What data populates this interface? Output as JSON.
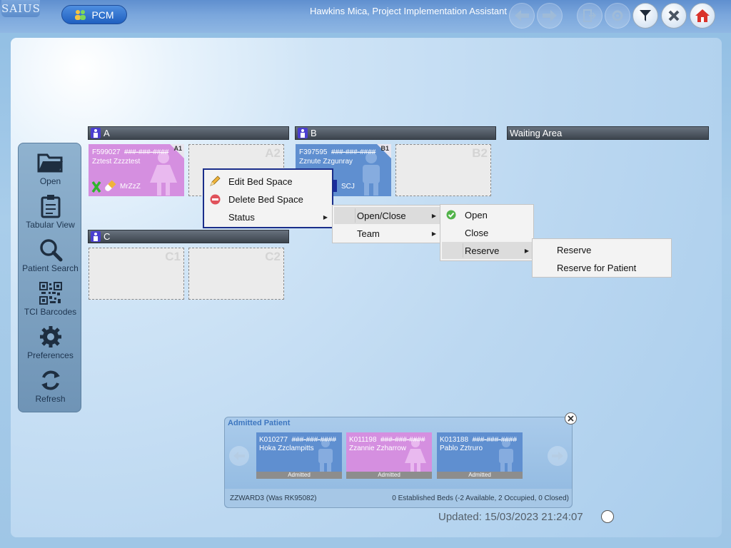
{
  "app": {
    "logo": "SAIUS",
    "module_button": "PCM",
    "user_title": "Hawkins Mica, Project Implementation Assistant"
  },
  "sidebar": {
    "items": [
      {
        "label": "Open",
        "icon": "folder-open-icon"
      },
      {
        "label": "Tabular View",
        "icon": "clipboard-icon"
      },
      {
        "label": "Patient Search",
        "icon": "magnifier-icon"
      },
      {
        "label": "TCI Barcodes",
        "icon": "qr-code-icon"
      },
      {
        "label": "Preferences",
        "icon": "gear-icon"
      },
      {
        "label": "Refresh",
        "icon": "refresh-icon"
      }
    ]
  },
  "groups": [
    {
      "name": "A"
    },
    {
      "name": "B"
    },
    {
      "name": "Waiting Area"
    },
    {
      "name": "C"
    }
  ],
  "beds": {
    "A1": {
      "id": "A1",
      "nhs": "F599027",
      "mask": "###-###-####",
      "name": "Zztest Zzzztest",
      "consultant": "MrZzZ",
      "color": "#d58fe0"
    },
    "A2": {
      "id": "A2"
    },
    "B1": {
      "id": "B1",
      "nhs": "F397595",
      "mask": "###-###-####",
      "name": "Zznute Zzgunray",
      "specialty": "SCJ",
      "color": "#5f8fd0"
    },
    "B2": {
      "id": "B2"
    },
    "C1": {
      "id": "C1"
    },
    "C2": {
      "id": "C2"
    }
  },
  "context_menu": {
    "main": [
      {
        "label": "Edit Bed Space",
        "icon": "pencil-icon"
      },
      {
        "label": "Delete Bed Space",
        "icon": "delete-icon"
      },
      {
        "label": "Status"
      }
    ],
    "status": [
      {
        "label": "Open/Close"
      },
      {
        "label": "Team"
      }
    ],
    "open_close": [
      {
        "label": "Open",
        "icon": "check-icon"
      },
      {
        "label": "Close"
      },
      {
        "label": "Reserve"
      }
    ],
    "reserve": [
      {
        "label": "Reserve"
      },
      {
        "label": "Reserve for Patient"
      }
    ]
  },
  "admitted": {
    "title": "Admitted Patient",
    "patients": [
      {
        "nhs": "K010277",
        "mask": "###-###-####",
        "name": "Hoka Zzclampitts",
        "status": "Admitted",
        "color": "#5f8fd0"
      },
      {
        "nhs": "K011198",
        "mask": "###-###-####",
        "name": "Zzannie Zzharrow",
        "status": "Admitted",
        "color": "#d58fe0"
      },
      {
        "nhs": "K013188",
        "mask": "###-###-####",
        "name": "Pablo Zztruro",
        "status": "Admitted",
        "color": "#5f8fd0"
      }
    ],
    "ward": "ZZWARD3 (Was RK95082)",
    "summary": "0 Established Beds (-2 Available, 2 Occupied, 0 Closed)"
  },
  "updated": "Updated: 15/03/2023 21:24:07"
}
